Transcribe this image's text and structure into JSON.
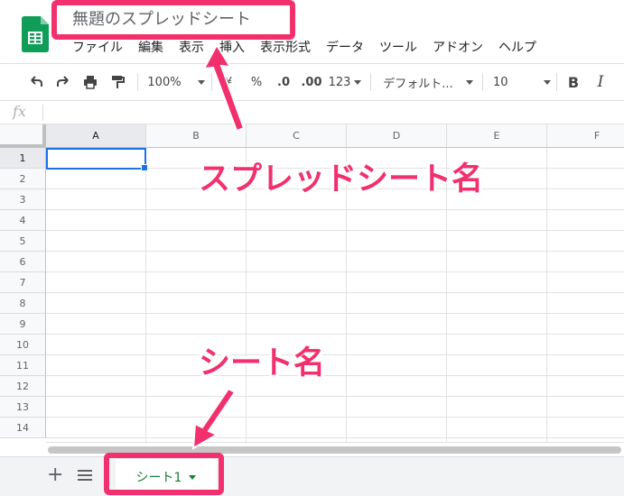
{
  "app": {
    "doc_title": "無題のスプレッドシート",
    "logo_icon": "google-sheets-icon"
  },
  "menu": [
    "ファイル",
    "編集",
    "表示",
    "挿入",
    "表示形式",
    "データ",
    "ツール",
    "アドオン",
    "ヘルプ"
  ],
  "toolbar": {
    "zoom": "100%",
    "percent": "%",
    "decimal_decrease": ".0",
    "decimal_increase": ".00",
    "number_format": "123",
    "font": "デフォルト...",
    "font_size": "10",
    "bold": "B",
    "italic": "I",
    "icons": [
      "undo-icon",
      "redo-icon",
      "print-icon",
      "paint-format-icon",
      "currency-icon"
    ]
  },
  "formula_bar": {
    "fx": "fx",
    "value": ""
  },
  "grid": {
    "columns": [
      "A",
      "B",
      "C",
      "D",
      "E",
      "F"
    ],
    "rows": [
      "1",
      "2",
      "3",
      "4",
      "5",
      "6",
      "7",
      "8",
      "9",
      "10",
      "11",
      "12",
      "13",
      "14"
    ],
    "active_cell": "A1"
  },
  "sheets": {
    "add_label": "+",
    "tabs": [
      {
        "label": "シート1",
        "active": true
      }
    ]
  },
  "annotations": {
    "spreadsheet_name_label": "スプレッドシート名",
    "sheet_name_label": "シート名",
    "color": "#f2306e"
  },
  "colors": {
    "accent_blue": "#1a73e8",
    "sheet_green": "#188038"
  }
}
